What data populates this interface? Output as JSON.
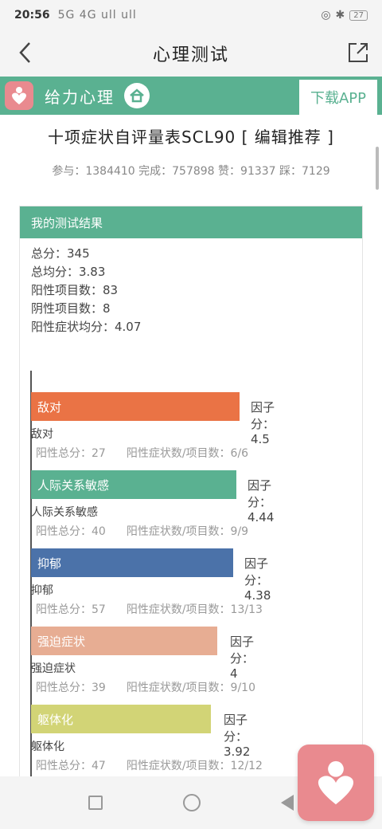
{
  "statusbar": {
    "time": "20:56",
    "signal": "5G 4G ull ull",
    "battery": "27"
  },
  "header": {
    "title": "心理测试"
  },
  "banner": {
    "brand": "给力心理",
    "download_label": "下载APP"
  },
  "test": {
    "title": "十项症状自评量表SCL90 [ 编辑推荐 ]",
    "stats": "参与：1384410 完成：757898 赞：91337 踩：7129"
  },
  "result": {
    "header": "我的测试结果",
    "summary": [
      "总分：345",
      "总均分：3.83",
      "阳性项目数：83",
      "阴性项目数：8",
      "阳性症状均分：4.07"
    ]
  },
  "factor_score_label": "因子分：",
  "factors": [
    {
      "name": "敌对",
      "score": "4.5",
      "total": "阳性总分：27",
      "ratio": "阳性症状数/项目数：6/6",
      "color": "#ea7345"
    },
    {
      "name": "人际关系敏感",
      "score": "4.44",
      "total": "阳性总分：40",
      "ratio": "阳性症状数/项目数：9/9",
      "color": "#5ab191"
    },
    {
      "name": "抑郁",
      "score": "4.38",
      "total": "阳性总分：57",
      "ratio": "阳性症状数/项目数：13/13",
      "color": "#4b72a9"
    },
    {
      "name": "强迫症状",
      "score": "4",
      "total": "阳性总分：39",
      "ratio": "阳性症状数/项目数：9/10",
      "color": "#e7ad93"
    },
    {
      "name": "躯体化",
      "score": "3.92",
      "total": "阳性总分：47",
      "ratio": "阳性症状数/项目数：12/12",
      "color": "#d2d476"
    }
  ],
  "icons": {
    "back": "chevron-left-icon",
    "share": "share-external-icon",
    "logo": "heart-person-icon",
    "home": "home-icon"
  }
}
